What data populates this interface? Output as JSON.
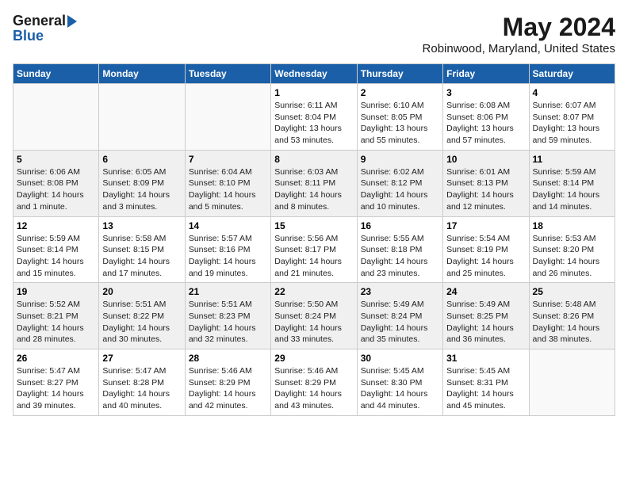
{
  "header": {
    "logo_general": "General",
    "logo_blue": "Blue",
    "title": "May 2024",
    "subtitle": "Robinwood, Maryland, United States"
  },
  "days_of_week": [
    "Sunday",
    "Monday",
    "Tuesday",
    "Wednesday",
    "Thursday",
    "Friday",
    "Saturday"
  ],
  "weeks": [
    {
      "days": [
        {
          "num": "",
          "info": ""
        },
        {
          "num": "",
          "info": ""
        },
        {
          "num": "",
          "info": ""
        },
        {
          "num": "1",
          "info": "Sunrise: 6:11 AM\nSunset: 8:04 PM\nDaylight: 13 hours and 53 minutes."
        },
        {
          "num": "2",
          "info": "Sunrise: 6:10 AM\nSunset: 8:05 PM\nDaylight: 13 hours and 55 minutes."
        },
        {
          "num": "3",
          "info": "Sunrise: 6:08 AM\nSunset: 8:06 PM\nDaylight: 13 hours and 57 minutes."
        },
        {
          "num": "4",
          "info": "Sunrise: 6:07 AM\nSunset: 8:07 PM\nDaylight: 13 hours and 59 minutes."
        }
      ]
    },
    {
      "days": [
        {
          "num": "5",
          "info": "Sunrise: 6:06 AM\nSunset: 8:08 PM\nDaylight: 14 hours and 1 minute."
        },
        {
          "num": "6",
          "info": "Sunrise: 6:05 AM\nSunset: 8:09 PM\nDaylight: 14 hours and 3 minutes."
        },
        {
          "num": "7",
          "info": "Sunrise: 6:04 AM\nSunset: 8:10 PM\nDaylight: 14 hours and 5 minutes."
        },
        {
          "num": "8",
          "info": "Sunrise: 6:03 AM\nSunset: 8:11 PM\nDaylight: 14 hours and 8 minutes."
        },
        {
          "num": "9",
          "info": "Sunrise: 6:02 AM\nSunset: 8:12 PM\nDaylight: 14 hours and 10 minutes."
        },
        {
          "num": "10",
          "info": "Sunrise: 6:01 AM\nSunset: 8:13 PM\nDaylight: 14 hours and 12 minutes."
        },
        {
          "num": "11",
          "info": "Sunrise: 5:59 AM\nSunset: 8:14 PM\nDaylight: 14 hours and 14 minutes."
        }
      ]
    },
    {
      "days": [
        {
          "num": "12",
          "info": "Sunrise: 5:59 AM\nSunset: 8:14 PM\nDaylight: 14 hours and 15 minutes."
        },
        {
          "num": "13",
          "info": "Sunrise: 5:58 AM\nSunset: 8:15 PM\nDaylight: 14 hours and 17 minutes."
        },
        {
          "num": "14",
          "info": "Sunrise: 5:57 AM\nSunset: 8:16 PM\nDaylight: 14 hours and 19 minutes."
        },
        {
          "num": "15",
          "info": "Sunrise: 5:56 AM\nSunset: 8:17 PM\nDaylight: 14 hours and 21 minutes."
        },
        {
          "num": "16",
          "info": "Sunrise: 5:55 AM\nSunset: 8:18 PM\nDaylight: 14 hours and 23 minutes."
        },
        {
          "num": "17",
          "info": "Sunrise: 5:54 AM\nSunset: 8:19 PM\nDaylight: 14 hours and 25 minutes."
        },
        {
          "num": "18",
          "info": "Sunrise: 5:53 AM\nSunset: 8:20 PM\nDaylight: 14 hours and 26 minutes."
        }
      ]
    },
    {
      "days": [
        {
          "num": "19",
          "info": "Sunrise: 5:52 AM\nSunset: 8:21 PM\nDaylight: 14 hours and 28 minutes."
        },
        {
          "num": "20",
          "info": "Sunrise: 5:51 AM\nSunset: 8:22 PM\nDaylight: 14 hours and 30 minutes."
        },
        {
          "num": "21",
          "info": "Sunrise: 5:51 AM\nSunset: 8:23 PM\nDaylight: 14 hours and 32 minutes."
        },
        {
          "num": "22",
          "info": "Sunrise: 5:50 AM\nSunset: 8:24 PM\nDaylight: 14 hours and 33 minutes."
        },
        {
          "num": "23",
          "info": "Sunrise: 5:49 AM\nSunset: 8:24 PM\nDaylight: 14 hours and 35 minutes."
        },
        {
          "num": "24",
          "info": "Sunrise: 5:49 AM\nSunset: 8:25 PM\nDaylight: 14 hours and 36 minutes."
        },
        {
          "num": "25",
          "info": "Sunrise: 5:48 AM\nSunset: 8:26 PM\nDaylight: 14 hours and 38 minutes."
        }
      ]
    },
    {
      "days": [
        {
          "num": "26",
          "info": "Sunrise: 5:47 AM\nSunset: 8:27 PM\nDaylight: 14 hours and 39 minutes."
        },
        {
          "num": "27",
          "info": "Sunrise: 5:47 AM\nSunset: 8:28 PM\nDaylight: 14 hours and 40 minutes."
        },
        {
          "num": "28",
          "info": "Sunrise: 5:46 AM\nSunset: 8:29 PM\nDaylight: 14 hours and 42 minutes."
        },
        {
          "num": "29",
          "info": "Sunrise: 5:46 AM\nSunset: 8:29 PM\nDaylight: 14 hours and 43 minutes."
        },
        {
          "num": "30",
          "info": "Sunrise: 5:45 AM\nSunset: 8:30 PM\nDaylight: 14 hours and 44 minutes."
        },
        {
          "num": "31",
          "info": "Sunrise: 5:45 AM\nSunset: 8:31 PM\nDaylight: 14 hours and 45 minutes."
        },
        {
          "num": "",
          "info": ""
        }
      ]
    }
  ]
}
